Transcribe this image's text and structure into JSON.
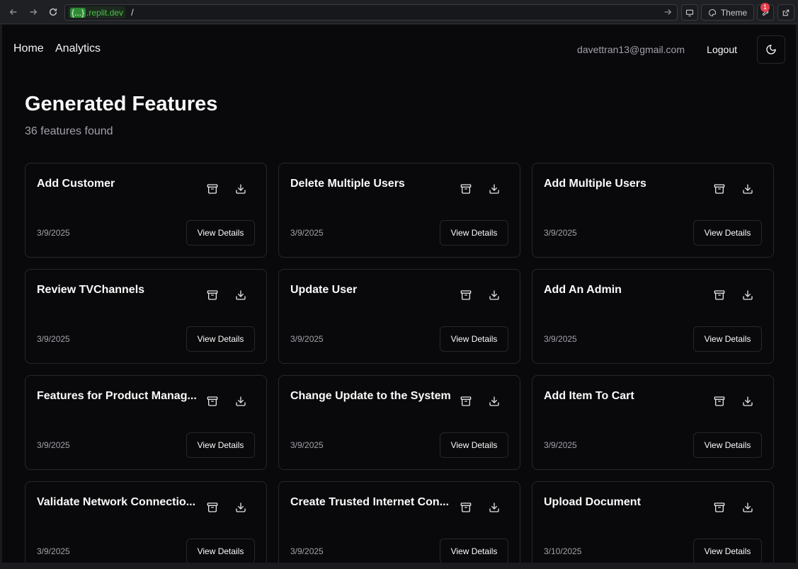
{
  "browser": {
    "host_badge": "{...}",
    "host": ".replit.dev",
    "path": "/",
    "theme_label": "Theme",
    "notification_count": "1"
  },
  "nav": {
    "home": "Home",
    "analytics": "Analytics",
    "user_email": "davettran13@gmail.com",
    "logout": "Logout"
  },
  "page": {
    "title": "Generated Features",
    "subtitle": "36 features found"
  },
  "cards": [
    {
      "title": "Add Customer",
      "date": "3/9/2025"
    },
    {
      "title": "Delete Multiple Users",
      "date": "3/9/2025"
    },
    {
      "title": "Add Multiple Users",
      "date": "3/9/2025"
    },
    {
      "title": "Review TVChannels",
      "date": "3/9/2025"
    },
    {
      "title": "Update User",
      "date": "3/9/2025"
    },
    {
      "title": "Add An Admin",
      "date": "3/9/2025"
    },
    {
      "title": "Features for Product Manag...",
      "date": "3/9/2025"
    },
    {
      "title": "Change Update to the System",
      "date": "3/9/2025"
    },
    {
      "title": "Add Item To Cart",
      "date": "3/9/2025"
    },
    {
      "title": "Validate Network Connectio...",
      "date": "3/9/2025"
    },
    {
      "title": "Create Trusted Internet Con...",
      "date": "3/9/2025"
    },
    {
      "title": "Upload Document",
      "date": "3/10/2025"
    }
  ],
  "card_button_label": "View Details",
  "icons": {
    "archive": "archive-icon",
    "download": "download-icon",
    "theme": "moon-icon"
  }
}
